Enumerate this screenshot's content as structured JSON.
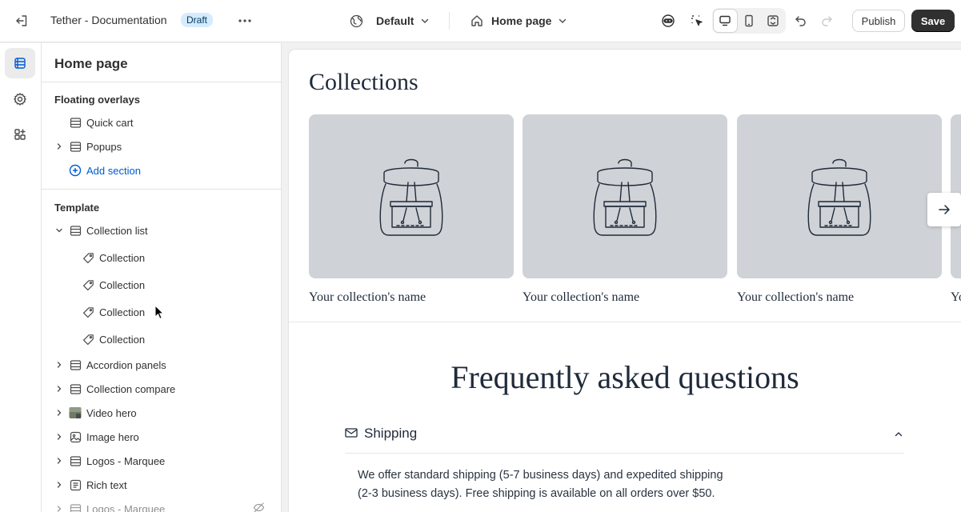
{
  "topbar": {
    "app_title": "Tether - Documentation",
    "status_badge": "Draft",
    "theme_select": "Default",
    "page_select": "Home page",
    "publish_label": "Publish",
    "save_label": "Save"
  },
  "sidebar": {
    "title": "Home page",
    "floating_heading": "Floating overlays",
    "floating_items": [
      {
        "label": "Quick cart",
        "icon": "section-icon",
        "expandable": false
      },
      {
        "label": "Popups",
        "icon": "section-icon",
        "expandable": true
      }
    ],
    "add_section_label": "Add section",
    "template_heading": "Template",
    "template_items": [
      {
        "label": "Collection list",
        "icon": "section-icon",
        "expanded": true
      },
      {
        "label": "Collection",
        "icon": "tag-icon"
      },
      {
        "label": "Collection",
        "icon": "tag-icon"
      },
      {
        "label": "Collection",
        "icon": "tag-icon"
      },
      {
        "label": "Collection",
        "icon": "tag-icon"
      },
      {
        "label": "Accordion panels",
        "icon": "section-icon"
      },
      {
        "label": "Collection compare",
        "icon": "section-icon"
      },
      {
        "label": "Video hero",
        "icon": "video-thumbnail-icon"
      },
      {
        "label": "Image hero",
        "icon": "image-icon"
      },
      {
        "label": "Logos - Marquee",
        "icon": "section-icon"
      },
      {
        "label": "Rich text",
        "icon": "text-icon"
      },
      {
        "label": "Logos - Marquee",
        "icon": "section-icon",
        "hidden": true
      }
    ]
  },
  "preview": {
    "collections_title": "Collections",
    "collection_names": [
      "Your collection's name",
      "Your collection's name",
      "Your collection's name",
      "Your collection's name"
    ],
    "faq_title": "Frequently asked questions",
    "faq_question": "Shipping",
    "faq_answer_line1": "We offer standard shipping (5-7 business days) and expedited shipping",
    "faq_answer_line2": "(2-3 business days). Free shipping is available on all orders over $50."
  },
  "colors": {
    "accent_link": "#005bd3",
    "save_button": "#303030",
    "badge_bg": "#d5ebff",
    "placeholder_bg": "#cfd2d6",
    "heading_serif": "#1f2a3a"
  }
}
